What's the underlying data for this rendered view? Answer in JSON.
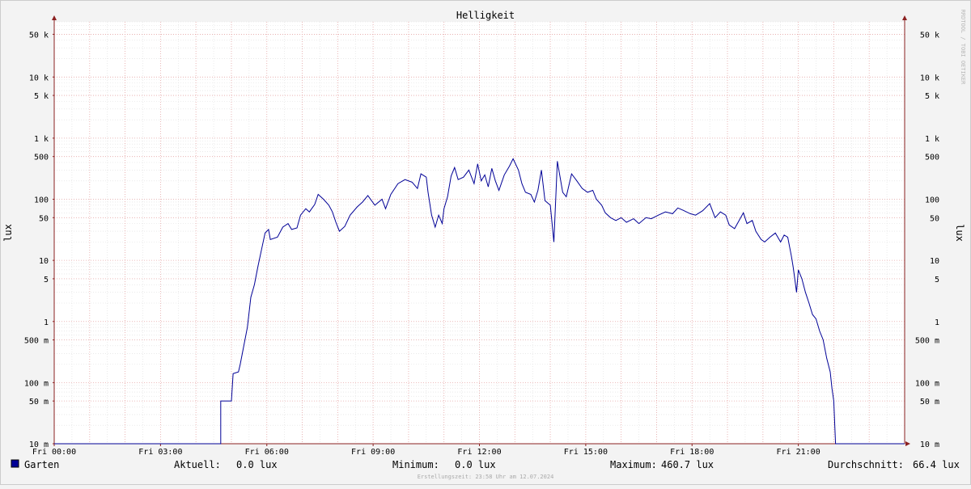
{
  "chart_data": {
    "type": "line",
    "title": "Helligkeit",
    "ylabel": "lux",
    "watermark": "RRDTOOL / TOBI OETIKER",
    "y_scale": "log",
    "ylim": [
      0.01,
      80000
    ],
    "y_ticks": [
      {
        "value": 50000,
        "label": "50 k"
      },
      {
        "value": 10000,
        "label": "10 k"
      },
      {
        "value": 5000,
        "label": "5 k"
      },
      {
        "value": 1000,
        "label": "1 k"
      },
      {
        "value": 500,
        "label": "500"
      },
      {
        "value": 100,
        "label": "100"
      },
      {
        "value": 50,
        "label": "50"
      },
      {
        "value": 10,
        "label": "10"
      },
      {
        "value": 5,
        "label": "5"
      },
      {
        "value": 1,
        "label": "1"
      },
      {
        "value": 0.5,
        "label": "500 m"
      },
      {
        "value": 0.1,
        "label": "100 m"
      },
      {
        "value": 0.05,
        "label": "50 m"
      },
      {
        "value": 0.01,
        "label": "10 m"
      }
    ],
    "x_ticks": [
      {
        "hour": 0,
        "label": "Fri 00:00"
      },
      {
        "hour": 3,
        "label": "Fri 03:00"
      },
      {
        "hour": 6,
        "label": "Fri 06:00"
      },
      {
        "hour": 9,
        "label": "Fri 09:00"
      },
      {
        "hour": 12,
        "label": "Fri 12:00"
      },
      {
        "hour": 15,
        "label": "Fri 15:00"
      },
      {
        "hour": 18,
        "label": "Fri 18:00"
      },
      {
        "hour": 21,
        "label": "Fri 21:00"
      }
    ],
    "xlim_hours": [
      0,
      24
    ],
    "grid": true,
    "series": [
      {
        "name": "Garten",
        "color": "#000096",
        "points": [
          [
            0.0,
            0.01
          ],
          [
            4.7,
            0.01
          ],
          [
            4.7,
            0.05
          ],
          [
            5.0,
            0.05
          ],
          [
            5.05,
            0.14
          ],
          [
            5.2,
            0.15
          ],
          [
            5.25,
            0.2
          ],
          [
            5.35,
            0.4
          ],
          [
            5.45,
            0.8
          ],
          [
            5.55,
            2.5
          ],
          [
            5.65,
            4
          ],
          [
            5.75,
            8
          ],
          [
            5.85,
            15
          ],
          [
            5.95,
            28
          ],
          [
            6.05,
            32
          ],
          [
            6.1,
            22
          ],
          [
            6.3,
            24
          ],
          [
            6.45,
            35
          ],
          [
            6.6,
            40
          ],
          [
            6.7,
            32
          ],
          [
            6.85,
            34
          ],
          [
            6.95,
            55
          ],
          [
            7.1,
            70
          ],
          [
            7.2,
            62
          ],
          [
            7.35,
            82
          ],
          [
            7.45,
            120
          ],
          [
            7.6,
            100
          ],
          [
            7.75,
            80
          ],
          [
            7.85,
            62
          ],
          [
            7.95,
            42
          ],
          [
            8.05,
            30
          ],
          [
            8.2,
            36
          ],
          [
            8.35,
            55
          ],
          [
            8.55,
            75
          ],
          [
            8.7,
            90
          ],
          [
            8.85,
            115
          ],
          [
            9.05,
            80
          ],
          [
            9.25,
            100
          ],
          [
            9.35,
            70
          ],
          [
            9.5,
            120
          ],
          [
            9.7,
            180
          ],
          [
            9.9,
            210
          ],
          [
            10.1,
            190
          ],
          [
            10.25,
            150
          ],
          [
            10.35,
            260
          ],
          [
            10.5,
            230
          ],
          [
            10.55,
            130
          ],
          [
            10.65,
            55
          ],
          [
            10.75,
            35
          ],
          [
            10.85,
            55
          ],
          [
            10.95,
            40
          ],
          [
            11.0,
            70
          ],
          [
            11.1,
            110
          ],
          [
            11.2,
            240
          ],
          [
            11.3,
            330
          ],
          [
            11.4,
            210
          ],
          [
            11.55,
            230
          ],
          [
            11.7,
            300
          ],
          [
            11.85,
            180
          ],
          [
            11.95,
            380
          ],
          [
            12.05,
            200
          ],
          [
            12.15,
            250
          ],
          [
            12.25,
            160
          ],
          [
            12.35,
            320
          ],
          [
            12.45,
            200
          ],
          [
            12.55,
            140
          ],
          [
            12.7,
            250
          ],
          [
            12.85,
            350
          ],
          [
            12.95,
            460
          ],
          [
            13.1,
            300
          ],
          [
            13.2,
            180
          ],
          [
            13.3,
            130
          ],
          [
            13.45,
            120
          ],
          [
            13.55,
            90
          ],
          [
            13.65,
            140
          ],
          [
            13.75,
            300
          ],
          [
            13.85,
            95
          ],
          [
            14.0,
            80
          ],
          [
            14.1,
            20
          ],
          [
            14.2,
            420
          ],
          [
            14.35,
            130
          ],
          [
            14.45,
            110
          ],
          [
            14.6,
            260
          ],
          [
            14.75,
            200
          ],
          [
            14.9,
            150
          ],
          [
            15.05,
            130
          ],
          [
            15.2,
            140
          ],
          [
            15.3,
            100
          ],
          [
            15.45,
            80
          ],
          [
            15.55,
            60
          ],
          [
            15.7,
            50
          ],
          [
            15.85,
            45
          ],
          [
            16.0,
            50
          ],
          [
            16.15,
            42
          ],
          [
            16.35,
            48
          ],
          [
            16.5,
            40
          ],
          [
            16.7,
            50
          ],
          [
            16.85,
            48
          ],
          [
            17.05,
            55
          ],
          [
            17.25,
            62
          ],
          [
            17.45,
            58
          ],
          [
            17.6,
            72
          ],
          [
            17.75,
            66
          ],
          [
            17.95,
            58
          ],
          [
            18.1,
            55
          ],
          [
            18.3,
            65
          ],
          [
            18.5,
            85
          ],
          [
            18.65,
            50
          ],
          [
            18.8,
            62
          ],
          [
            18.95,
            55
          ],
          [
            19.05,
            38
          ],
          [
            19.2,
            33
          ],
          [
            19.3,
            42
          ],
          [
            19.45,
            60
          ],
          [
            19.55,
            40
          ],
          [
            19.7,
            45
          ],
          [
            19.8,
            30
          ],
          [
            19.95,
            22
          ],
          [
            20.05,
            20
          ],
          [
            20.2,
            24
          ],
          [
            20.35,
            28
          ],
          [
            20.5,
            20
          ],
          [
            20.6,
            26
          ],
          [
            20.7,
            24
          ],
          [
            20.8,
            12
          ],
          [
            20.85,
            8
          ],
          [
            20.9,
            5
          ],
          [
            20.95,
            3
          ],
          [
            21.0,
            7
          ],
          [
            21.1,
            5
          ],
          [
            21.2,
            3
          ],
          [
            21.3,
            2
          ],
          [
            21.4,
            1.3
          ],
          [
            21.5,
            1.1
          ],
          [
            21.6,
            0.7
          ],
          [
            21.7,
            0.5
          ],
          [
            21.8,
            0.25
          ],
          [
            21.9,
            0.15
          ],
          [
            21.95,
            0.08
          ],
          [
            22.0,
            0.05
          ],
          [
            22.05,
            0.01
          ],
          [
            24.0,
            0.01
          ]
        ]
      }
    ]
  },
  "legend": {
    "series_name": "Garten",
    "swatch_color": "#000096",
    "current_label": "Aktuell:",
    "current_value": "0.0 lux",
    "min_label": "Minimum:",
    "min_value": "0.0 lux",
    "max_label": "Maximum:",
    "max_value": "460.7 lux",
    "avg_label": "Durchschnitt:",
    "avg_value": "66.4 lux"
  },
  "footer": "Erstellungszeit: 23:58 Uhr am 12.07.2024"
}
